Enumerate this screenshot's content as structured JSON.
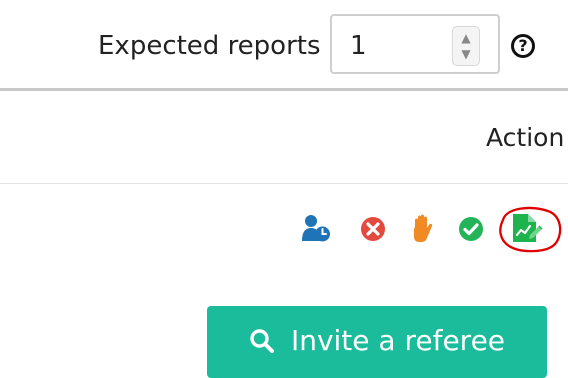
{
  "reports": {
    "label": "Expected reports",
    "value": "1",
    "spinner_icon": "chevron-up-down-icon",
    "help_icon": "question-circle-icon"
  },
  "table": {
    "action_header": "Action"
  },
  "actions": [
    {
      "name": "assign-referee",
      "icon": "user-clock-icon",
      "color": "#1f74b7"
    },
    {
      "name": "decline",
      "icon": "x-circle-icon",
      "color": "#e24a3f"
    },
    {
      "name": "stop",
      "icon": "hand-icon",
      "color": "#f08a24"
    },
    {
      "name": "accept",
      "icon": "check-circle-icon",
      "color": "#25b35a"
    },
    {
      "name": "report",
      "icon": "document-chart-icon",
      "color": "#1db34d"
    }
  ],
  "annotation": {
    "color": "#e00000"
  },
  "invite": {
    "label": "Invite a referee",
    "icon": "search-icon",
    "color": "#1bbc9b"
  }
}
